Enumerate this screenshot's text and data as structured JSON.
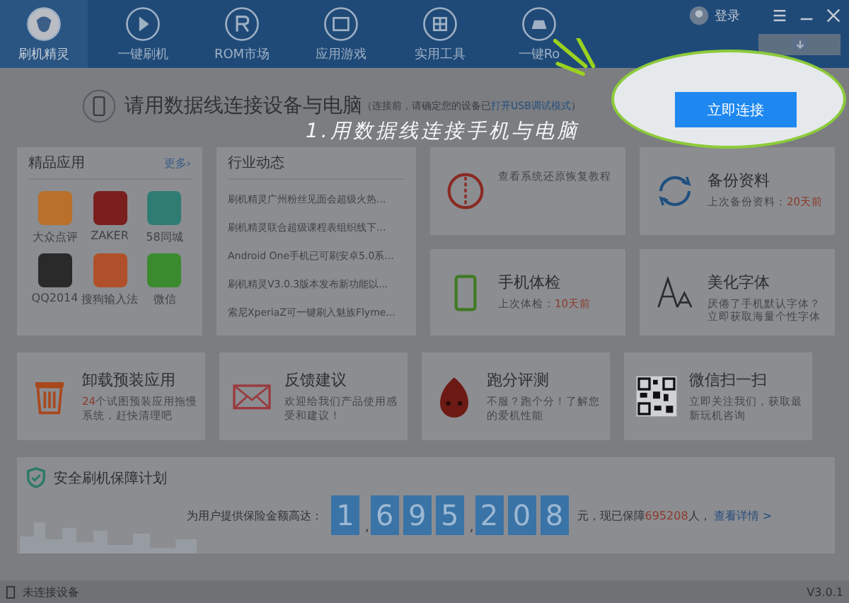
{
  "nav": {
    "tabs": [
      {
        "label": "刷机精灵",
        "kind": "home",
        "selected": true
      },
      {
        "label": "一键刷机",
        "kind": "flash",
        "selected": false
      },
      {
        "label": "ROM市场",
        "kind": "rom",
        "selected": false
      },
      {
        "label": "应用游戏",
        "kind": "apps",
        "selected": false
      },
      {
        "label": "实用工具",
        "kind": "tools",
        "selected": false
      },
      {
        "label": "一键Ro",
        "kind": "root",
        "selected": false
      }
    ],
    "login": "登录"
  },
  "connect": {
    "title": "请用数据线连接设备与电脑",
    "note": "（连接前，请确定您的设备已",
    "link": "打开USB调试模式",
    "note_end": "）",
    "button": "立即连接"
  },
  "annotation": "1.用数据线连接手机与电脑",
  "apps_card": {
    "title": "精品应用",
    "more": "更多›",
    "apps": [
      {
        "name": "大众点评",
        "color": "#b8702a"
      },
      {
        "name": "ZAKER",
        "color": "#7a1e1e"
      },
      {
        "name": "58同城",
        "color": "#2f7c72"
      },
      {
        "name": "QQ2014",
        "color": "#2a2a2a"
      },
      {
        "name": "搜狗输入法",
        "color": "#b0502a"
      },
      {
        "name": "微信",
        "color": "#3a8a2e"
      }
    ]
  },
  "news_card": {
    "title": "行业动态",
    "items": [
      "刷机精灵广州粉丝见面会超级火热...",
      "刷机精灵联合超级课程表组织线下...",
      "Android One手机已可刷安卓5.0系...",
      "刷机精灵V3.0.3版本发布新功能以...",
      "索尼XperiaZ可一键刷入魅族Flyme..."
    ]
  },
  "tiles": [
    {
      "kind": "rescue",
      "parts": [
        {
          "text": "查看系统还原恢复教程",
          "accent": false
        }
      ]
    },
    {
      "kind": "backup",
      "title": "备份资料",
      "parts": [
        {
          "text": "上次备份资料：",
          "accent": false
        },
        {
          "text": "20天前",
          "accent": true
        }
      ]
    },
    {
      "kind": "checkup",
      "title": "手机体检",
      "parts": [
        {
          "text": "上次体检：",
          "accent": false
        },
        {
          "text": "10天前",
          "accent": true
        }
      ]
    },
    {
      "kind": "font",
      "title": "美化字体",
      "parts": [
        {
          "text": "厌倦了手机默认字体？立即获取海量个性字体",
          "accent": false
        }
      ]
    }
  ],
  "bottom_tiles": [
    {
      "kind": "trash",
      "title": "卸载预装应用",
      "parts": [
        {
          "text": "24",
          "accent": true
        },
        {
          "text": "个试图预装应用拖慢系统，赶快清理吧",
          "accent": false
        }
      ]
    },
    {
      "kind": "mail",
      "title": "反馈建议",
      "parts": [
        {
          "text": "欢迎给我们产品使用感受和建议！",
          "accent": false
        }
      ]
    },
    {
      "kind": "bench",
      "title": "跑分评测",
      "parts": [
        {
          "text": "不服？跑个分！了解您的爱机性能",
          "accent": false
        }
      ]
    },
    {
      "kind": "qr",
      "title": "微信扫一扫",
      "parts": [
        {
          "text": "立即关注我们，获取最新玩机咨询",
          "accent": false
        }
      ]
    }
  ],
  "banner": {
    "title": "安全刷机保障计划",
    "lead": "为用户提供保险金额高达：",
    "groups": [
      [
        "1"
      ],
      [
        "6",
        "9",
        "5"
      ],
      [
        "2",
        "0",
        "8"
      ]
    ],
    "separator": ",",
    "after": "元，现已保障",
    "count": "695208",
    "count_unit": "人，",
    "link": "查看详情 >"
  },
  "status_bar": {
    "device": "未连接设备",
    "version": "V3.0.1"
  }
}
